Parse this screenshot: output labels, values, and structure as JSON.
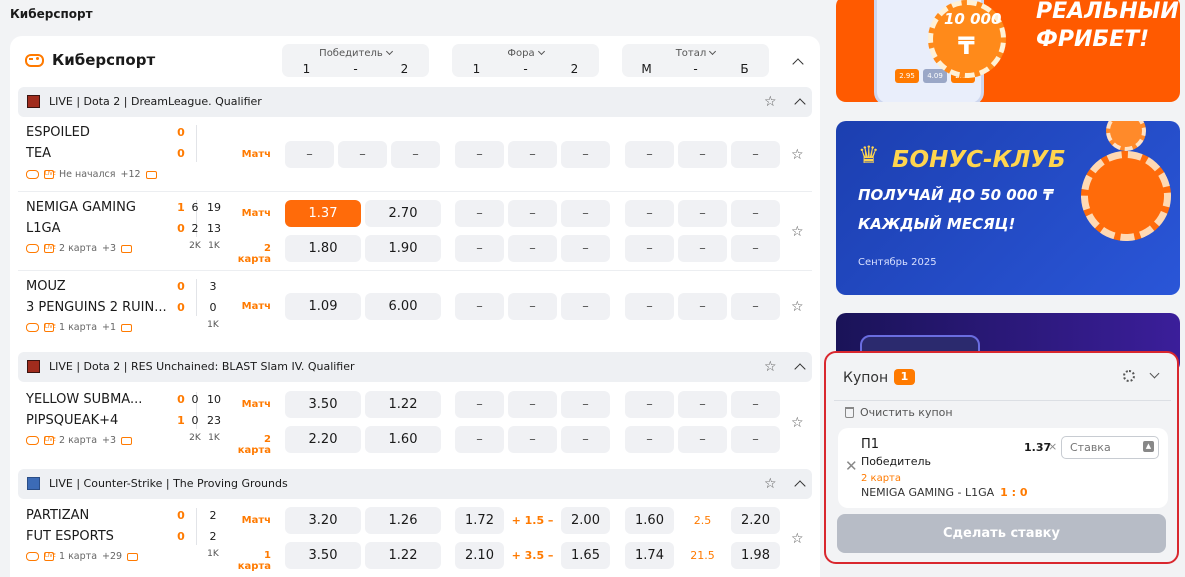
{
  "breadcrumb": "Киберспорт",
  "panel_title": "Киберспорт",
  "columns": [
    {
      "title": "Победитель",
      "labels": [
        "1",
        "-",
        "2"
      ]
    },
    {
      "title": "Фора",
      "labels": [
        "1",
        "-",
        "2"
      ]
    },
    {
      "title": "Тотал",
      "labels": [
        "М",
        "-",
        "Б"
      ]
    }
  ],
  "leagues": [
    {
      "name": "LIVE | Dota 2 | DreamLeague. Qualifier"
    },
    {
      "name": "LIVE | Dota 2 | RES Unchained: BLAST Slam IV. Qualifier"
    },
    {
      "name": "LIVE | Counter-Strike | The Proving Grounds"
    }
  ],
  "matches": [
    {
      "team1": "ESPOILED",
      "team2": "TEA",
      "score1": "0",
      "score2": "0",
      "s1": [],
      "s2": [],
      "maps": [],
      "status": "Не начался",
      "more": "+12",
      "rows": [
        {
          "period": "Матч",
          "odds": [
            "–",
            "–",
            "–",
            "–",
            "–",
            "–",
            "–",
            "–",
            "–"
          ]
        }
      ]
    },
    {
      "team1": "NEMIGA GAMING",
      "team2": "L1GA",
      "score1": "1",
      "score2": "0",
      "s1": [
        "6",
        "19"
      ],
      "s2": [
        "2",
        "13"
      ],
      "maps": [
        "2K",
        "1K"
      ],
      "status": "2 карта",
      "more": "+3",
      "rows": [
        {
          "period": "Матч",
          "odds": [
            "1.37",
            "",
            "2.70",
            "–",
            "–",
            "–",
            "–",
            "–",
            "–"
          ]
        },
        {
          "period": "2 карта",
          "odds": [
            "1.80",
            "",
            "1.90",
            "–",
            "–",
            "–",
            "–",
            "–",
            "–"
          ]
        }
      ]
    },
    {
      "team1": "MOUZ",
      "team2": "3 PENGUINS 2 RUIN...",
      "score1": "0",
      "score2": "0",
      "s1": [
        "3"
      ],
      "s2": [
        "0"
      ],
      "maps": [
        "1K"
      ],
      "status": "1 карта",
      "more": "+1",
      "rows": [
        {
          "period": "Матч",
          "odds": [
            "1.09",
            "",
            "6.00",
            "–",
            "–",
            "–",
            "–",
            "–",
            "–"
          ]
        }
      ]
    },
    {
      "team1": "YELLOW SUBMA...",
      "team2": "PIPSQUEAK+4",
      "score1": "0",
      "score2": "1",
      "s1": [
        "0",
        "10"
      ],
      "s2": [
        "0",
        "23"
      ],
      "maps": [
        "2K",
        "1K"
      ],
      "status": "2 карта",
      "more": "+3",
      "rows": [
        {
          "period": "Матч",
          "odds": [
            "3.50",
            "",
            "1.22",
            "–",
            "–",
            "–",
            "–",
            "–",
            "–"
          ]
        },
        {
          "period": "2 карта",
          "odds": [
            "2.20",
            "",
            "1.60",
            "–",
            "–",
            "–",
            "–",
            "–",
            "–"
          ]
        }
      ]
    },
    {
      "team1": "PARTIZAN",
      "team2": "FUT ESPORTS",
      "score1": "0",
      "score2": "0",
      "s1": [
        "2"
      ],
      "s2": [
        "2"
      ],
      "maps": [
        "1K"
      ],
      "status": "1 карта",
      "more": "+29",
      "rows": [
        {
          "period": "Матч",
          "odds": [
            "3.20",
            "",
            "1.26",
            "1.72",
            "+ 1.5 –",
            "2.00",
            "1.60",
            "2.5",
            "2.20"
          ]
        },
        {
          "period": "1 карта",
          "odds": [
            "3.50",
            "",
            "1.22",
            "2.10",
            "+ 3.5 –",
            "1.65",
            "1.74",
            "21.5",
            "1.98"
          ]
        }
      ]
    }
  ],
  "banners": {
    "b1_amount": "10 000",
    "b1_text": "РЕАЛЬНЫЙ ФРИБЕТ!",
    "b1_odds": [
      "2.95",
      "4.09",
      "2.19"
    ],
    "b2_title": "БОНУС-КЛУБ",
    "b2_line1": "ПОЛУЧАЙ ДО 50 000 ₸",
    "b2_line2": "КАЖДЫЙ МЕСЯЦ!",
    "b2_date": "Сентябрь 2025"
  },
  "coupon": {
    "title": "Купон",
    "count": "1",
    "clear_label": "Очистить купон",
    "pick": "П1",
    "market": "Победитель",
    "period": "2 карта",
    "match": "NEMIGA GAMING - L1GA",
    "match_score": "1 : 0",
    "odd": "1.37",
    "stake_placeholder": "Ставка",
    "submit_label": "Сделать ставку"
  },
  "colors": {
    "accent": "#ff7a00",
    "selected_odd": "#ff6b0a",
    "coupon_border": "#d9272e"
  }
}
